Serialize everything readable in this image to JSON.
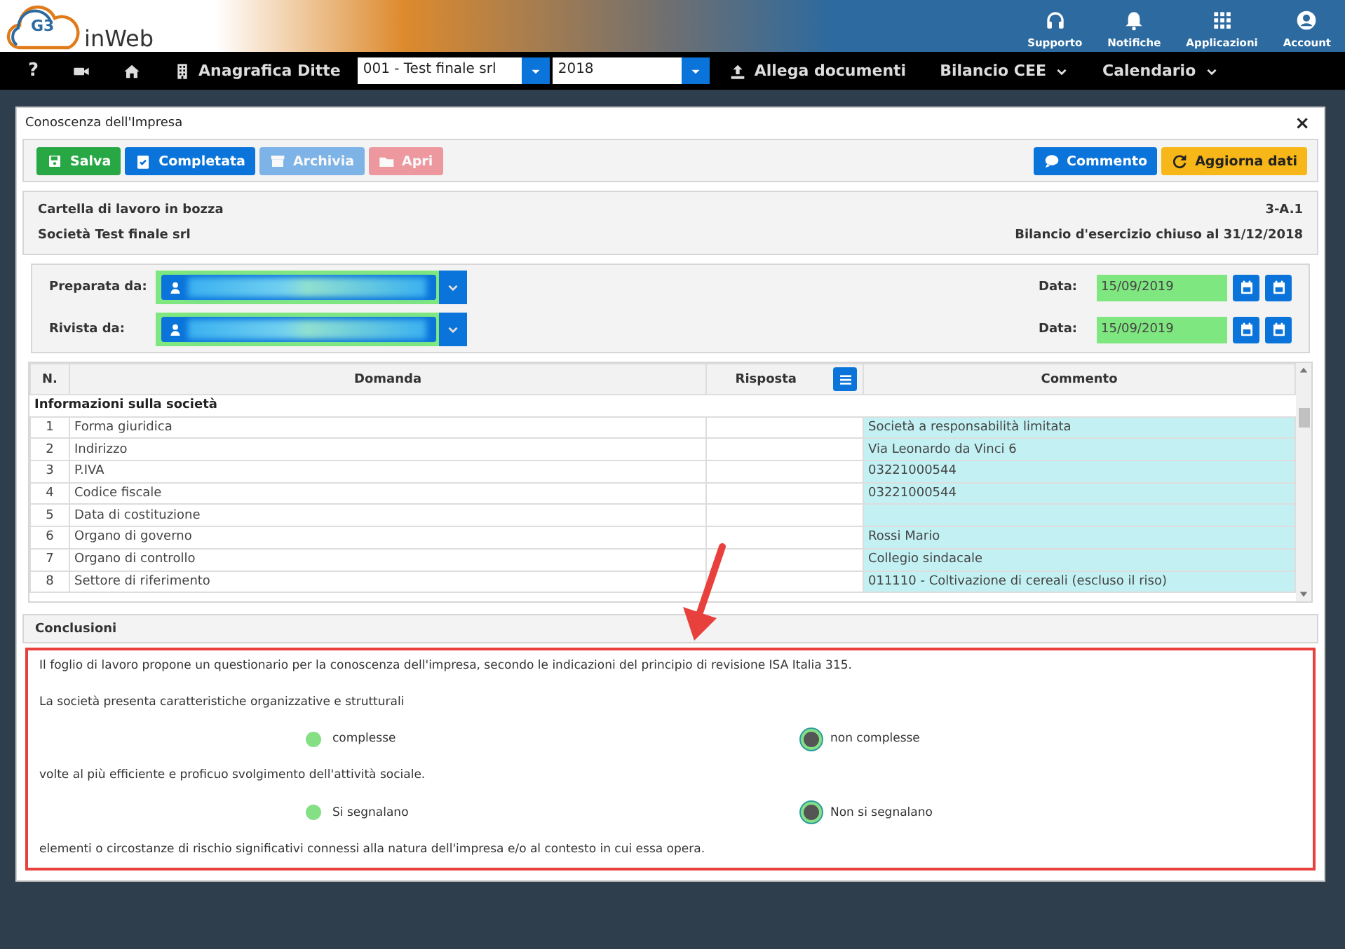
{
  "header": {
    "logo_mark": "G3",
    "logo_text": "inWeb",
    "actions": [
      {
        "kind": "headset",
        "label": "Supporto"
      },
      {
        "kind": "bell",
        "label": "Notifiche"
      },
      {
        "kind": "grid",
        "label": "Applicazioni"
      },
      {
        "kind": "account",
        "label": "Account"
      }
    ]
  },
  "nav": {
    "items": [
      {
        "kind": "glyph",
        "label": "?"
      },
      {
        "kind": "video"
      },
      {
        "kind": "home"
      },
      {
        "kind": "building",
        "label": "Anagrafica Ditte"
      },
      {
        "kind": "select",
        "value": "001 - Test finale srl"
      },
      {
        "kind": "select",
        "value": "2018"
      },
      {
        "kind": "upload",
        "label": "Allega documenti"
      },
      {
        "kind": "menu",
        "label": "Bilancio CEE"
      },
      {
        "kind": "menu",
        "label": "Calendario"
      }
    ]
  },
  "panel": {
    "title": "Conoscenza dell'Impresa",
    "close": "×",
    "toolbar": [
      {
        "kind": "save",
        "label": "Salva",
        "disabled": false
      },
      {
        "kind": "complete",
        "label": "Completata",
        "disabled": false
      },
      {
        "kind": "archive",
        "label": "Archivia",
        "disabled": true
      },
      {
        "kind": "open",
        "label": "Apri",
        "disabled": true
      },
      {
        "kind": "comment",
        "label": "Commento",
        "disabled": false
      },
      {
        "kind": "refresh",
        "label": "Aggiorna dati",
        "disabled": false
      }
    ],
    "info": [
      {
        "left": "Cartella di lavoro in bozza",
        "right": "3-A.1"
      },
      {
        "left": "Società Test finale srl",
        "right": "Bilancio d'esercizio chiuso al 31/12/2018"
      }
    ],
    "signoff": [
      {
        "label": "Preparata da:",
        "date_label": "Data:",
        "date": "15/09/2019"
      },
      {
        "label": "Rivista da:",
        "date_label": "Data:",
        "date": "15/09/2019"
      }
    ],
    "table": {
      "columns": [
        "N.",
        "Domanda",
        "Risposta",
        "Commento"
      ],
      "sections": [
        {
          "title": "Informazioni sulla società",
          "rows": [
            {
              "n": "1",
              "question": "Forma giuridica",
              "comment": "Società a responsabilità limitata"
            },
            {
              "n": "2",
              "question": "Indirizzo",
              "comment": "Via Leonardo da Vinci 6"
            },
            {
              "n": "3",
              "question": "P.IVA",
              "comment": "03221000544"
            },
            {
              "n": "4",
              "question": "Codice fiscale",
              "comment": "03221000544"
            },
            {
              "n": "5",
              "question": "Data di costituzione"
            },
            {
              "n": "6",
              "question": "Organo di governo",
              "comment": "Rossi Mario"
            },
            {
              "n": "7",
              "question": "Organo di controllo",
              "comment": "Collegio sindacale"
            },
            {
              "n": "8",
              "question": "Settore di riferimento",
              "comment": "011110 - Coltivazione di cereali (escluso il riso)"
            }
          ]
        }
      ]
    },
    "conclusions": {
      "title": "Conclusioni",
      "blocks": [
        {
          "kind": "text",
          "text": "Il foglio di lavoro propone un questionario per la conoscenza dell'impresa, secondo le indicazioni del principio di revisione ISA Italia 315."
        },
        {
          "kind": "text",
          "text": "La società presenta caratteristiche organizzative e strutturali"
        },
        {
          "kind": "radios",
          "options": [
            {
              "label": "complesse",
              "selected": false
            },
            {
              "label": "non complesse",
              "selected": true
            }
          ]
        },
        {
          "kind": "text",
          "text": "volte al più efficiente e proficuo svolgimento dell'attività sociale."
        },
        {
          "kind": "radios",
          "options": [
            {
              "label": "Si segnalano",
              "selected": false
            },
            {
              "label": "Non si segnalano",
              "selected": true
            }
          ]
        },
        {
          "kind": "text",
          "text": "elementi o circostanze di rischio significativi connessi alla natura dell'impresa e/o al contesto in cui essa opera."
        }
      ]
    }
  }
}
